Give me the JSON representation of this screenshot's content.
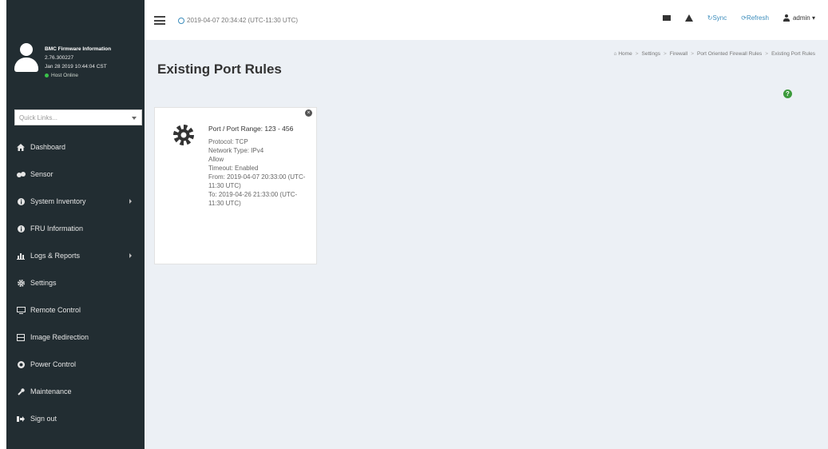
{
  "topbar": {
    "datetime": "2019-04-07 20:34:42 (UTC-11:30 UTC)",
    "sync_label": "Sync",
    "refresh_label": "Refresh",
    "user_label": "admin"
  },
  "sidebar": {
    "profile": {
      "title": "BMC Firmware Information",
      "version": "2.76.300227",
      "build_date": "Jan 28 2019 10:44:04 CST",
      "status": "Host Online"
    },
    "quicklinks_placeholder": "Quick Links...",
    "items": [
      {
        "label": "Dashboard",
        "icon": "dashboard-icon",
        "has_submenu": false
      },
      {
        "label": "Sensor",
        "icon": "sensor-icon",
        "has_submenu": false
      },
      {
        "label": "System Inventory",
        "icon": "info-icon",
        "has_submenu": true
      },
      {
        "label": "FRU Information",
        "icon": "info-icon",
        "has_submenu": false
      },
      {
        "label": "Logs & Reports",
        "icon": "chart-icon",
        "has_submenu": true
      },
      {
        "label": "Settings",
        "icon": "gear-icon",
        "has_submenu": false
      },
      {
        "label": "Remote Control",
        "icon": "monitor-icon",
        "has_submenu": false
      },
      {
        "label": "Image Redirection",
        "icon": "image-icon",
        "has_submenu": false
      },
      {
        "label": "Power Control",
        "icon": "power-icon",
        "has_submenu": false
      },
      {
        "label": "Maintenance",
        "icon": "wrench-icon",
        "has_submenu": false
      },
      {
        "label": "Sign out",
        "icon": "signout-icon",
        "has_submenu": false
      }
    ]
  },
  "main": {
    "title": "Existing Port Rules",
    "breadcrumb": [
      "Home",
      "Settings",
      "Firewall",
      "Port Oriented Firewall Rules",
      "Existing Port Rules"
    ],
    "rule_card": {
      "range": "Port / Port Range: 123 - 456",
      "protocol": "Protocol: TCP",
      "network": "Network Type: IPv4",
      "action": "Allow",
      "timeout": "Timeout: Enabled",
      "from": "From: 2019-04-07 20:33:00 (UTC-11:30 UTC)",
      "to": "To: 2019-04-26 21:33:00 (UTC-11:30 UTC)"
    }
  },
  "colors": {
    "sidebar_bg": "#222d32",
    "content_bg": "#ecf0f5",
    "accent": "#3c8dbc",
    "online_dot": "#3ac24a"
  }
}
